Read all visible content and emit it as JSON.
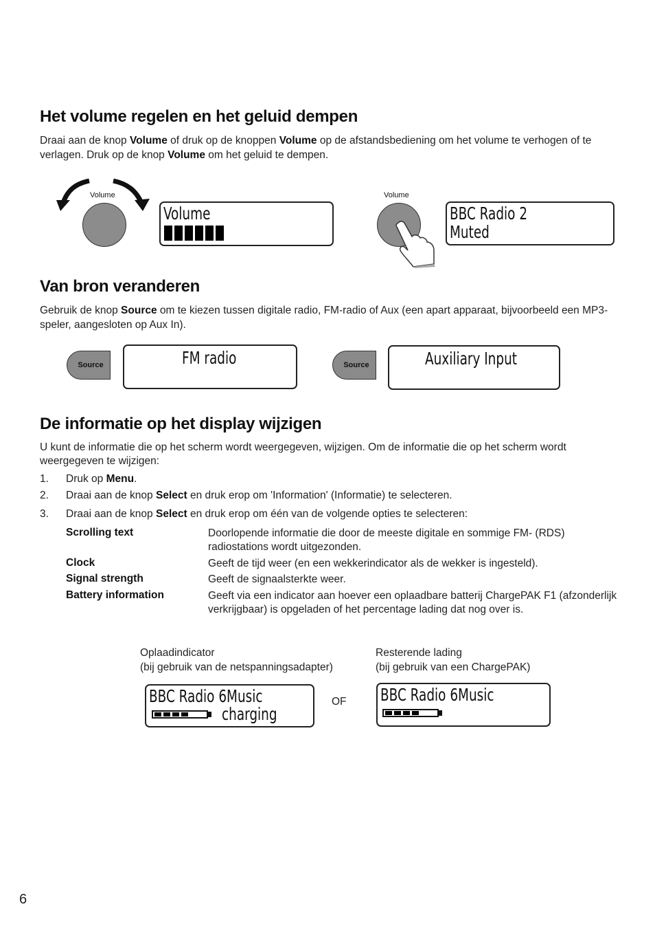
{
  "page_number": "6",
  "section_volume": {
    "heading": "Het volume regelen en het geluid dempen",
    "para": [
      {
        "t": "Draai aan de knop ",
        "b": false
      },
      {
        "t": "Volume",
        "b": true
      },
      {
        "t": " of druk op de knoppen ",
        "b": false
      },
      {
        "t": "Volume",
        "b": true
      },
      {
        "t": " op de afstandsbediening om het volume te verhogen of te verlagen. Druk op de knop ",
        "b": false
      },
      {
        "t": "Volume",
        "b": true
      },
      {
        "t": " om het geluid te dempen.",
        "b": false
      }
    ],
    "knob_label_left": "Volume",
    "knob_label_right": "Volume",
    "display_volume": {
      "line1": "Volume",
      "level_bars": 6
    },
    "display_muted": {
      "line1": "BBC Radio 2",
      "line2": "Muted"
    }
  },
  "section_source": {
    "heading": "Van bron veranderen",
    "para": [
      {
        "t": "Gebruik de knop ",
        "b": false
      },
      {
        "t": "Source",
        "b": true
      },
      {
        "t": " om te kiezen tussen digitale radio, FM-radio of Aux (een apart apparaat, bijvoorbeeld een MP3-speler, aangesloten op Aux In).",
        "b": false
      }
    ],
    "button_label_left": "Source",
    "button_label_right": "Source",
    "display_left": "FM radio",
    "display_right": "Auxiliary Input"
  },
  "section_display": {
    "heading": "De informatie op het display wijzigen",
    "intro": "U kunt de informatie die op het scherm wordt weergegeven, wijzigen. Om de informatie die op het scherm wordt weergegeven te wijzigen:",
    "steps": [
      {
        "num": "1.",
        "pre": "Druk op ",
        "bold": "Menu",
        "post": "."
      },
      {
        "num": "2.",
        "pre": "Draai aan de knop ",
        "bold": "Select",
        "post": " en druk erop om 'Information' (Informatie) te selecteren."
      },
      {
        "num": "3.",
        "pre": "Draai aan de knop ",
        "bold": "Select",
        "post": " en druk erop om één van de volgende opties te selecteren:"
      }
    ],
    "options": [
      {
        "term": "Scrolling text",
        "desc": "Doorlopende informatie die door de meeste digitale en sommige FM- (RDS) radiostations wordt uitgezonden."
      },
      {
        "term": "Clock",
        "desc": "Geeft de tijd weer (en een wekkerindicator als de wekker is ingesteld)."
      },
      {
        "term": "Signal strength",
        "desc": "Geeft de signaalsterkte weer."
      },
      {
        "term": "Battery information",
        "desc": "Geeft via een indicator aan hoever een oplaadbare batterij ChargePAK F1 (afzonderlijk verkrijgbaar) is opgeladen of het percentage lading dat nog over is."
      }
    ],
    "caption_left": {
      "line1": "Oplaadindicator",
      "line2": "(bij gebruik van de netspanningsadapter)"
    },
    "caption_right": {
      "line1": "Resterende lading",
      "line2": "(bij gebruik van een ChargePAK)"
    },
    "or_label": "OF",
    "display_charging": {
      "line1": "BBC Radio 6Music",
      "line2": "charging",
      "battery_segments": 4
    },
    "display_remaining": {
      "line1": "BBC Radio 6Music",
      "battery_segments": 4
    }
  }
}
